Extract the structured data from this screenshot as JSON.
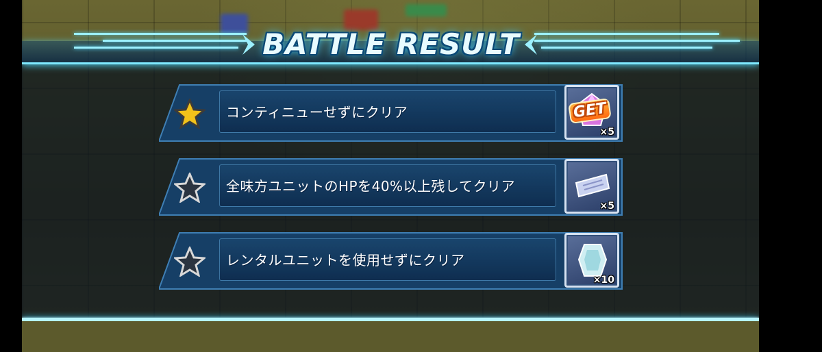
{
  "header": {
    "title": "BATTLE RESULT"
  },
  "missions": [
    {
      "label": "コンティニューせずにクリア",
      "achieved": true,
      "reward_icon": "crystal-icon",
      "reward_badge": "GET",
      "reward_qty": "×5"
    },
    {
      "label": "全味方ユニットのHPを40%以上残してクリア",
      "achieved": false,
      "reward_icon": "ticket-icon",
      "reward_qty": "×5"
    },
    {
      "label": "レンタルユニットを使用せずにクリア",
      "achieved": false,
      "reward_icon": "medal-icon",
      "reward_qty": "×10"
    }
  ],
  "colors": {
    "accent": "#7fe8ff",
    "star_gold": "#f2c21a",
    "plate": "#16446e"
  }
}
